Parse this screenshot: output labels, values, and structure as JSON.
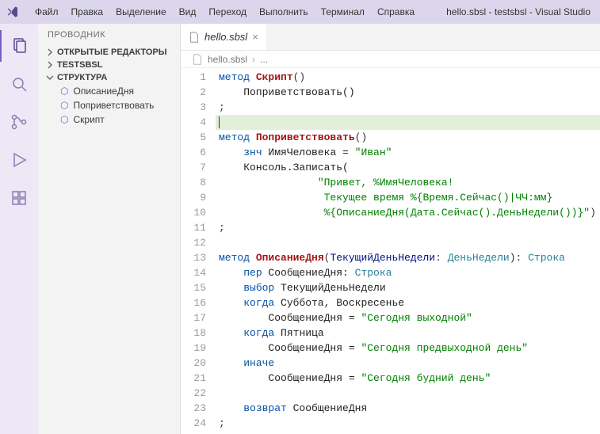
{
  "title": "hello.sbsl - testsbsl - Visual Studio",
  "menu": [
    "Файл",
    "Правка",
    "Выделение",
    "Вид",
    "Переход",
    "Выполнить",
    "Терминал",
    "Справка"
  ],
  "sidebar": {
    "title": "ПРОВОДНИК",
    "sections": {
      "open_editors": "ОТКРЫТЫЕ РЕДАКТОРЫ",
      "workspace": "TESTSBSL",
      "outline": "СТРУКТУРА"
    },
    "outline_items": [
      "ОписаниеДня",
      "Поприветствовать",
      "Скрипт"
    ]
  },
  "tab": {
    "label": "hello.sbsl"
  },
  "breadcrumb": {
    "file": "hello.sbsl",
    "more": "..."
  },
  "code": {
    "lines": [
      {
        "n": 1,
        "tokens": [
          [
            "kw",
            "метод "
          ],
          [
            "name",
            "Скрипт"
          ],
          [
            "op",
            "()"
          ]
        ]
      },
      {
        "n": 2,
        "tokens": [
          [
            "txt",
            "    Поприветствовать()"
          ]
        ]
      },
      {
        "n": 3,
        "tokens": [
          [
            "op",
            ";"
          ]
        ]
      },
      {
        "n": 4,
        "hl": true,
        "tokens": [
          [
            "cursor",
            ""
          ]
        ]
      },
      {
        "n": 5,
        "tokens": [
          [
            "kw",
            "метод "
          ],
          [
            "name",
            "Поприветствовать"
          ],
          [
            "op",
            "()"
          ]
        ]
      },
      {
        "n": 6,
        "tokens": [
          [
            "txt",
            "    "
          ],
          [
            "kw",
            "знч"
          ],
          [
            "txt",
            " ИмяЧеловека = "
          ],
          [
            "str",
            "\"Иван\""
          ]
        ]
      },
      {
        "n": 7,
        "tokens": [
          [
            "txt",
            "    Консоль.Записать("
          ]
        ]
      },
      {
        "n": 8,
        "tokens": [
          [
            "txt",
            "                "
          ],
          [
            "str",
            "\"Привет, %ИмяЧеловека!"
          ]
        ]
      },
      {
        "n": 9,
        "tokens": [
          [
            "txt",
            "                 "
          ],
          [
            "str",
            "Текущее время %{Время.Сейчас()|ЧЧ:мм}"
          ]
        ]
      },
      {
        "n": 10,
        "tokens": [
          [
            "txt",
            "                 "
          ],
          [
            "str",
            "%{ОписаниеДня(Дата.Сейчас().ДеньНедели())}\""
          ],
          [
            "op",
            ")"
          ]
        ]
      },
      {
        "n": 11,
        "tokens": [
          [
            "op",
            ";"
          ]
        ]
      },
      {
        "n": 12,
        "tokens": []
      },
      {
        "n": 13,
        "tokens": [
          [
            "kw",
            "метод "
          ],
          [
            "name",
            "ОписаниеДня"
          ],
          [
            "op",
            "("
          ],
          [
            "param",
            "ТекущийДеньНедели"
          ],
          [
            "op",
            ": "
          ],
          [
            "type",
            "ДеньНедели"
          ],
          [
            "op",
            "): "
          ],
          [
            "type",
            "Строка"
          ]
        ]
      },
      {
        "n": 14,
        "tokens": [
          [
            "txt",
            "    "
          ],
          [
            "kw",
            "пер"
          ],
          [
            "txt",
            " СообщениеДня: "
          ],
          [
            "type",
            "Строка"
          ]
        ]
      },
      {
        "n": 15,
        "tokens": [
          [
            "txt",
            "    "
          ],
          [
            "kw",
            "выбор"
          ],
          [
            "txt",
            " ТекущийДеньНедели"
          ]
        ]
      },
      {
        "n": 16,
        "tokens": [
          [
            "txt",
            "    "
          ],
          [
            "kw",
            "когда"
          ],
          [
            "txt",
            " Суббота, Воскресенье"
          ]
        ]
      },
      {
        "n": 17,
        "tokens": [
          [
            "txt",
            "        СообщениеДня = "
          ],
          [
            "str",
            "\"Сегодня выходной\""
          ]
        ]
      },
      {
        "n": 18,
        "tokens": [
          [
            "txt",
            "    "
          ],
          [
            "kw",
            "когда"
          ],
          [
            "txt",
            " Пятница"
          ]
        ]
      },
      {
        "n": 19,
        "tokens": [
          [
            "txt",
            "        СообщениеДня = "
          ],
          [
            "str",
            "\"Сегодня предвыходной день\""
          ]
        ]
      },
      {
        "n": 20,
        "tokens": [
          [
            "txt",
            "    "
          ],
          [
            "kw",
            "иначе"
          ]
        ]
      },
      {
        "n": 21,
        "tokens": [
          [
            "txt",
            "        СообщениеДня = "
          ],
          [
            "str",
            "\"Сегодня будний день\""
          ]
        ]
      },
      {
        "n": 22,
        "tokens": []
      },
      {
        "n": 23,
        "tokens": [
          [
            "txt",
            "    "
          ],
          [
            "kw",
            "возврат"
          ],
          [
            "txt",
            " СообщениеДня"
          ]
        ]
      },
      {
        "n": 24,
        "tokens": [
          [
            "op",
            ";"
          ]
        ]
      }
    ]
  }
}
